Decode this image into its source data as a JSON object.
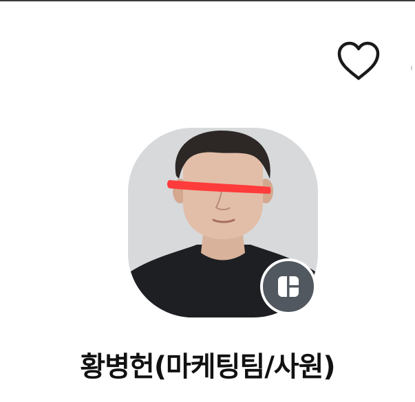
{
  "profile": {
    "name": "황병헌(마케팅팀/사원)"
  },
  "icons": {
    "favorite": "heart-outline-icon",
    "badge": "layout-icon"
  },
  "colors": {
    "text": "#111111",
    "badge_background": "#52585f",
    "censor_bar": "#ff3b3b",
    "divider": "#3a3a3a"
  }
}
